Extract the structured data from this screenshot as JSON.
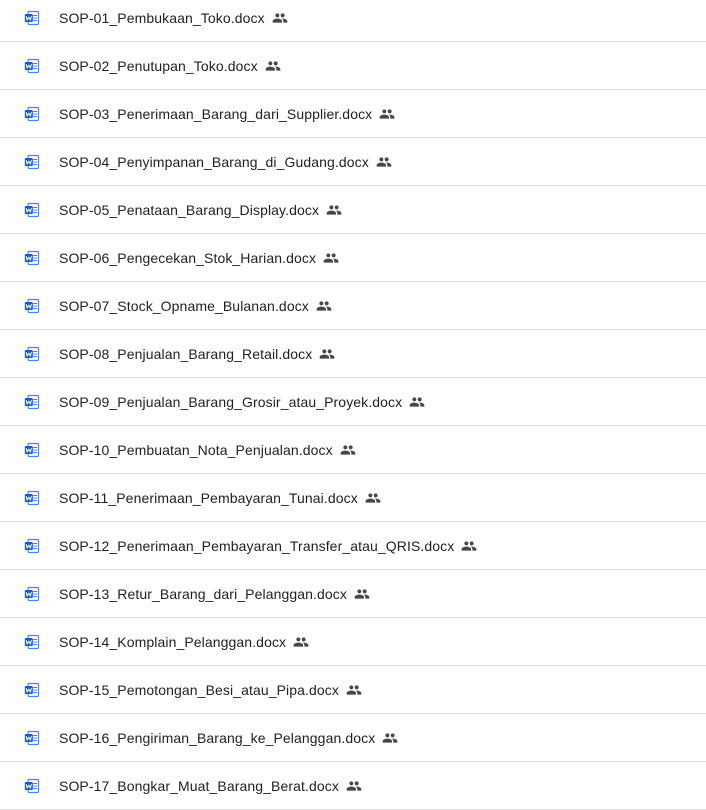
{
  "files": [
    {
      "name": "SOP-01_Pembukaan_Toko.docx",
      "type_icon": "word-doc-icon",
      "shared_icon": "shared-people-icon"
    },
    {
      "name": "SOP-02_Penutupan_Toko.docx",
      "type_icon": "word-doc-icon",
      "shared_icon": "shared-people-icon"
    },
    {
      "name": "SOP-03_Penerimaan_Barang_dari_Supplier.docx",
      "type_icon": "word-doc-icon",
      "shared_icon": "shared-people-icon"
    },
    {
      "name": "SOP-04_Penyimpanan_Barang_di_Gudang.docx",
      "type_icon": "word-doc-icon",
      "shared_icon": "shared-people-icon"
    },
    {
      "name": "SOP-05_Penataan_Barang_Display.docx",
      "type_icon": "word-doc-icon",
      "shared_icon": "shared-people-icon"
    },
    {
      "name": "SOP-06_Pengecekan_Stok_Harian.docx",
      "type_icon": "word-doc-icon",
      "shared_icon": "shared-people-icon"
    },
    {
      "name": "SOP-07_Stock_Opname_Bulanan.docx",
      "type_icon": "word-doc-icon",
      "shared_icon": "shared-people-icon"
    },
    {
      "name": "SOP-08_Penjualan_Barang_Retail.docx",
      "type_icon": "word-doc-icon",
      "shared_icon": "shared-people-icon"
    },
    {
      "name": "SOP-09_Penjualan_Barang_Grosir_atau_Proyek.docx",
      "type_icon": "word-doc-icon",
      "shared_icon": "shared-people-icon"
    },
    {
      "name": "SOP-10_Pembuatan_Nota_Penjualan.docx",
      "type_icon": "word-doc-icon",
      "shared_icon": "shared-people-icon"
    },
    {
      "name": "SOP-11_Penerimaan_Pembayaran_Tunai.docx",
      "type_icon": "word-doc-icon",
      "shared_icon": "shared-people-icon"
    },
    {
      "name": "SOP-12_Penerimaan_Pembayaran_Transfer_atau_QRIS.docx",
      "type_icon": "word-doc-icon",
      "shared_icon": "shared-people-icon"
    },
    {
      "name": "SOP-13_Retur_Barang_dari_Pelanggan.docx",
      "type_icon": "word-doc-icon",
      "shared_icon": "shared-people-icon"
    },
    {
      "name": "SOP-14_Komplain_Pelanggan.docx",
      "type_icon": "word-doc-icon",
      "shared_icon": "shared-people-icon"
    },
    {
      "name": "SOP-15_Pemotongan_Besi_atau_Pipa.docx",
      "type_icon": "word-doc-icon",
      "shared_icon": "shared-people-icon"
    },
    {
      "name": "SOP-16_Pengiriman_Barang_ke_Pelanggan.docx",
      "type_icon": "word-doc-icon",
      "shared_icon": "shared-people-icon"
    },
    {
      "name": "SOP-17_Bongkar_Muat_Barang_Berat.docx",
      "type_icon": "word-doc-icon",
      "shared_icon": "shared-people-icon"
    }
  ],
  "colors": {
    "word_blue": "#4285f4",
    "word_dark": "#1a5fb4",
    "divider": "#dadce0",
    "text": "#1f1f1f",
    "icon_gray": "#444746"
  }
}
